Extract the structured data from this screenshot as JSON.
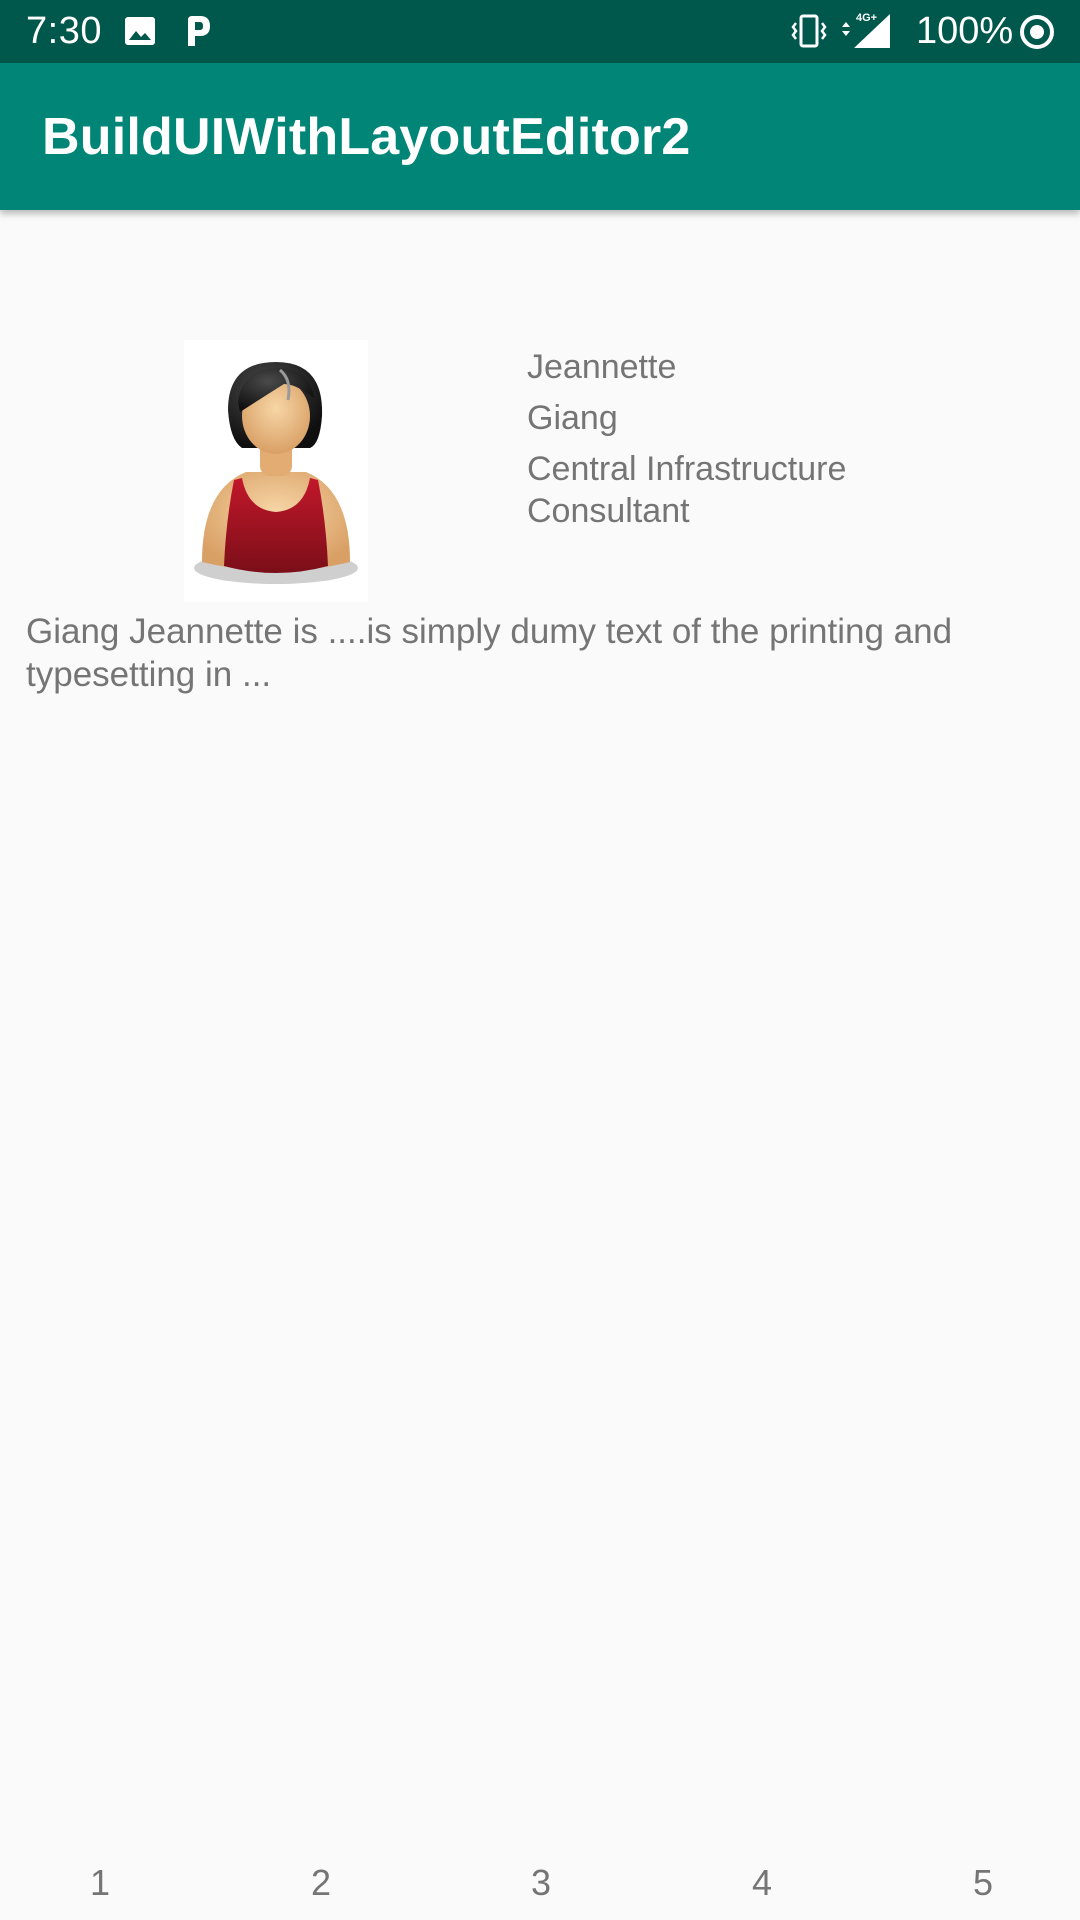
{
  "status_bar": {
    "time": "7:30",
    "battery": "100%",
    "network": "4G+",
    "icons": [
      "gallery-icon",
      "p-icon",
      "vibrate-icon",
      "signal-icon",
      "sync-icon"
    ]
  },
  "app_bar": {
    "title": "BuildUIWithLayoutEditor2"
  },
  "profile": {
    "first_name": "Jeannette",
    "last_name": "Giang",
    "job_title": "Central Infrastructure Consultant",
    "description": "Giang Jeannette is ....is simply dumy text of the printing and typesetting in ..."
  },
  "bottom_nav": {
    "items": [
      "1",
      "2",
      "3",
      "4",
      "5"
    ]
  },
  "colors": {
    "status_bar": "#00574b",
    "app_bar": "#008577",
    "background": "#fafafa",
    "text_secondary": "#757575"
  }
}
